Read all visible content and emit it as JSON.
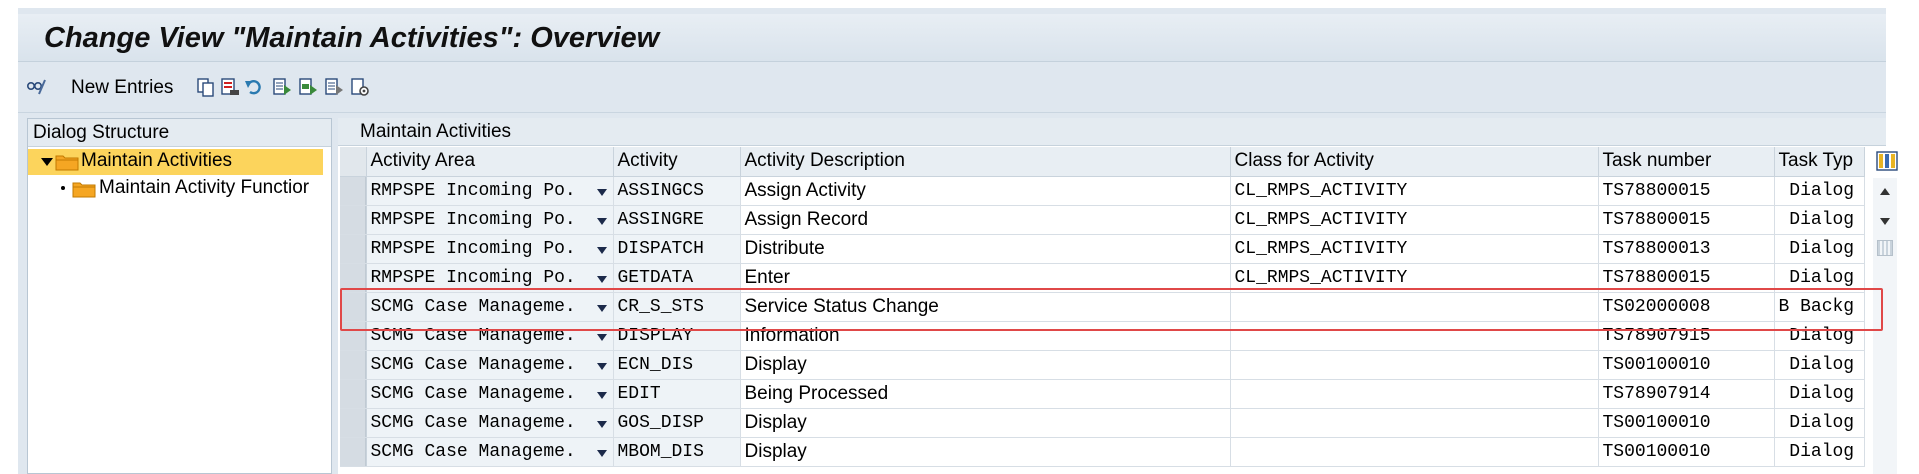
{
  "window": {
    "title": "Change View \"Maintain Activities\": Overview"
  },
  "toolbar": {
    "new_entries_label": "New Entries",
    "icons": [
      "display-change-icon",
      "copy-icon",
      "delete-icon",
      "undo-icon",
      "select-all-icon",
      "select-block-icon",
      "deselect-all-icon",
      "configure-icon"
    ]
  },
  "dialog_structure": {
    "title": "Dialog Structure",
    "items": [
      {
        "label": "Maintain Activities",
        "selected": true
      },
      {
        "label": "Maintain Activity Functior",
        "selected": false
      }
    ]
  },
  "grid": {
    "title": "Maintain Activities",
    "columns": [
      "Activity Area",
      "Activity",
      "Activity Description",
      "Class for Activity",
      "Task number",
      "Task Typ"
    ],
    "rows": [
      {
        "area": "RMPSPE Incoming Po.",
        "activity": "ASSINGCS",
        "description": "Assign Activity",
        "class": "CL_RMPS_ACTIVITY",
        "task": "TS78800015",
        "type": " Dialog"
      },
      {
        "area": "RMPSPE Incoming Po.",
        "activity": "ASSINGRE",
        "description": "Assign Record",
        "class": "CL_RMPS_ACTIVITY",
        "task": "TS78800015",
        "type": " Dialog"
      },
      {
        "area": "RMPSPE Incoming Po.",
        "activity": "DISPATCH",
        "description": "Distribute",
        "class": "CL_RMPS_ACTIVITY",
        "task": "TS78800013",
        "type": " Dialog"
      },
      {
        "area": "RMPSPE Incoming Po.",
        "activity": "GETDATA",
        "description": "Enter",
        "class": "CL_RMPS_ACTIVITY",
        "task": "TS78800015",
        "type": " Dialog"
      },
      {
        "area": "SCMG Case Manageme.",
        "activity": "CR_S_STS",
        "description": "Service Status Change",
        "class": "",
        "task": "TS02000008",
        "type": "B Backg"
      },
      {
        "area": "SCMG Case Manageme.",
        "activity": "DISPLAY",
        "description": "Information",
        "class": "",
        "task": "TS78907915",
        "type": " Dialog"
      },
      {
        "area": "SCMG Case Manageme.",
        "activity": "ECN_DIS",
        "description": "Display",
        "class": "",
        "task": "TS00100010",
        "type": " Dialog"
      },
      {
        "area": "SCMG Case Manageme.",
        "activity": "EDIT",
        "description": "Being Processed",
        "class": "",
        "task": "TS78907914",
        "type": " Dialog"
      },
      {
        "area": "SCMG Case Manageme.",
        "activity": "GOS_DISP",
        "description": "Display",
        "class": "",
        "task": "TS00100010",
        "type": " Dialog"
      },
      {
        "area": "SCMG Case Manageme.",
        "activity": "MBOM_DIS",
        "description": "Display",
        "class": "",
        "task": "TS00100010",
        "type": " Dialog"
      }
    ]
  },
  "colors": {
    "selection": "#fcd45c",
    "highlight_box": "#e04848",
    "header_bg": "#e4ebf1"
  }
}
